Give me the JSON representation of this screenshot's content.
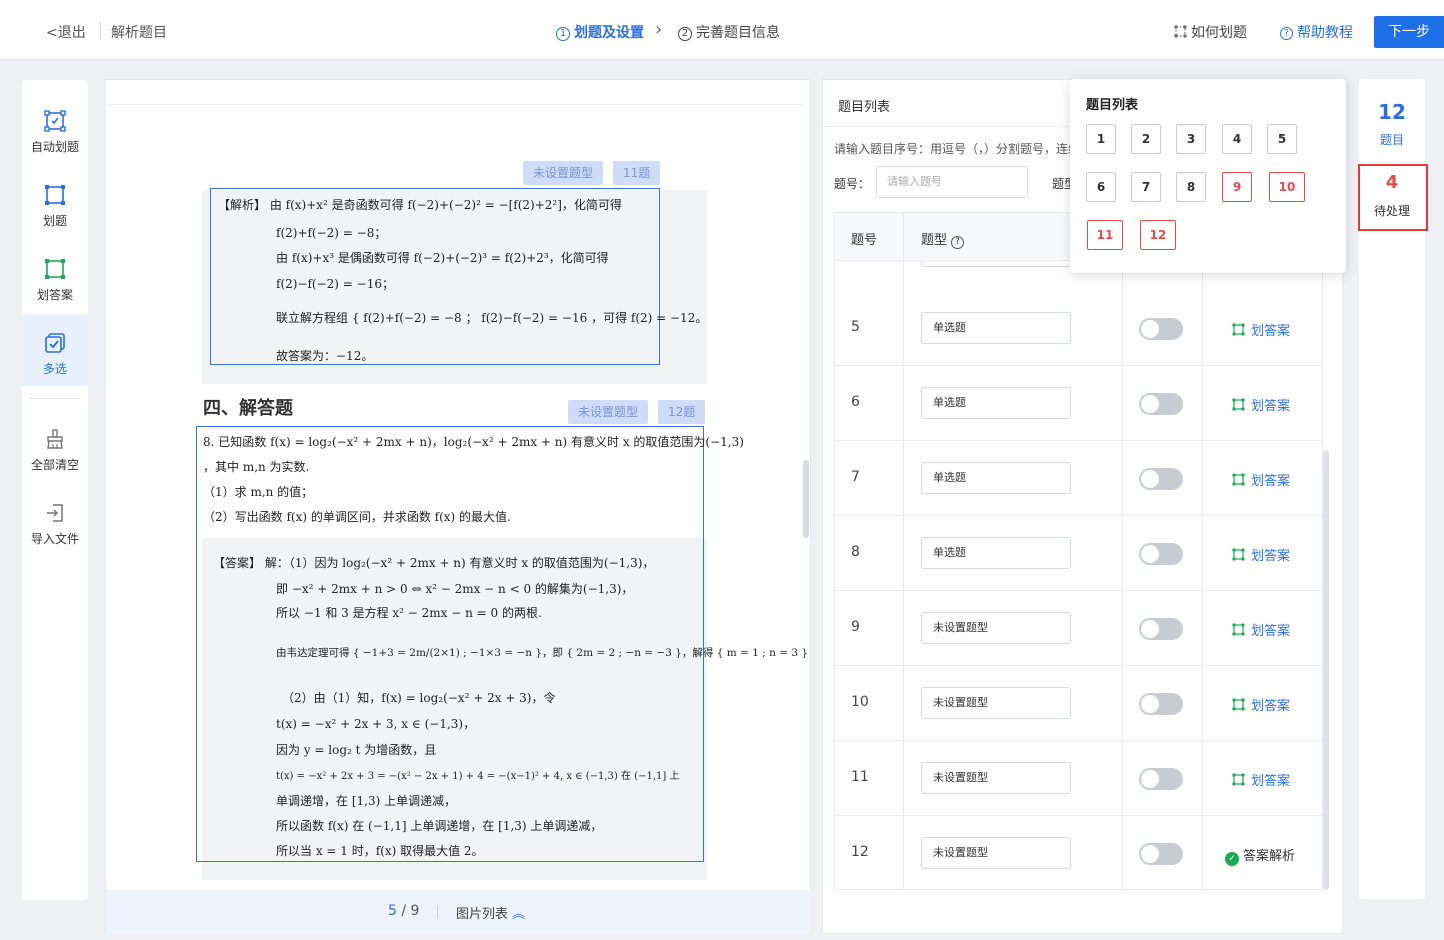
{
  "header": {
    "back_label": "退出",
    "page_title": "解析题目",
    "step1_num": "1",
    "step1_label": "划题及设置",
    "step2_num": "2",
    "step2_label": "完善题目信息",
    "howto_label": "如何划题",
    "help_label": "帮助教程",
    "next_label": "下一步"
  },
  "toolbar": {
    "items": [
      {
        "label": "自动划题",
        "icon": "auto-select-icon"
      },
      {
        "label": "划题",
        "icon": "frame-icon"
      },
      {
        "label": "划答案",
        "icon": "answer-frame-icon"
      },
      {
        "label": "多选",
        "icon": "multi-select-icon"
      },
      {
        "label": "全部清空",
        "icon": "broom-icon"
      },
      {
        "label": "导入文件",
        "icon": "import-icon"
      }
    ]
  },
  "document": {
    "tag_unset_1": "未设置题型",
    "tag_q11": "11题",
    "tag_unset_2": "未设置题型",
    "tag_q12": "12题",
    "section_title": "四、解答题",
    "analysis_lines": [
      "【解析】  由 f(x)+x² 是奇函数可得 f(−2)+(−2)² = −[f(2)+2²]，化简可得",
      "f(2)+f(−2) = −8；",
      "由 f(x)+x³ 是偶函数可得 f(−2)+(−2)³ = f(2)+2³，化简可得",
      "f(2)−f(−2) = −16；",
      "联立解方程组 { f(2)+f(−2) = −8 ； f(2)−f(−2) = −16 ，可得 f(2) = −12。",
      "故答案为：−12。"
    ],
    "question_lines": [
      "8. 已知函数 f(x) = log₂(−x² + 2mx + n)，log₂(−x² + 2mx + n) 有意义时 x 的取值范围为(−1,3)",
      "，其中 m,n 为实数.",
      "（1）求 m,n 的值；",
      "（2）写出函数 f(x) 的单调区间，并求函数 f(x) 的最大值."
    ],
    "answer_lines": [
      "【答案】  解：（1）因为 log₂(−x² + 2mx + n) 有意义时 x 的取值范围为(−1,3)，",
      "即 −x² + 2mx + n > 0 ⇔ x² − 2mx − n < 0 的解集为(−1,3)，",
      "所以 −1 和 3 是方程 x² − 2mx − n = 0 的两根.",
      "由韦达定理可得 { −1+3 = 2m/(2×1) ; −1×3 = −n }，即 { 2m = 2 ; −n = −3 }，解得 { m = 1 ; n = 3 }",
      "（2）由（1）知，f(x) = log₂(−x² + 2x + 3)，令",
      "t(x) = −x² + 2x + 3, x ∈ (−1,3)，",
      "因为 y = log₂ t 为增函数，且",
      "t(x) = −x² + 2x + 3 = −(x² − 2x + 1) + 4 = −(x−1)² + 4, x ∈ (−1,3) 在 (−1,1] 上",
      "单调递增，在 [1,3) 上单调递减，",
      "所以函数 f(x) 在 (−1,1] 上单调递增，在 [1,3) 上单调递减，",
      "所以当 x = 1 时，f(x) 取得最大值 2。"
    ],
    "pager_current": "5",
    "pager_sep": " / ",
    "pager_total": "9",
    "image_list_label": "图片列表"
  },
  "question_panel": {
    "title": "题目列表",
    "hint": "请输入题目序号：用逗号（，）分割题号，连续题号用短横线连接",
    "qnum_label": "题号：",
    "qnum_placeholder": "请输入题号",
    "qtype_label": "题型",
    "col_num": "题号",
    "col_type": "题型",
    "rows": [
      {
        "num": "5",
        "type": "单选题",
        "toggle": false,
        "action": "划答案",
        "done": false
      },
      {
        "num": "6",
        "type": "单选题",
        "toggle": false,
        "action": "划答案",
        "done": false
      },
      {
        "num": "7",
        "type": "单选题",
        "toggle": false,
        "action": "划答案",
        "done": false
      },
      {
        "num": "8",
        "type": "单选题",
        "toggle": false,
        "action": "划答案",
        "done": false
      },
      {
        "num": "9",
        "type": "未设置题型",
        "toggle": false,
        "action": "划答案",
        "done": false
      },
      {
        "num": "10",
        "type": "未设置题型",
        "toggle": false,
        "action": "划答案",
        "done": false
      },
      {
        "num": "11",
        "type": "未设置题型",
        "toggle": false,
        "action": "划答案",
        "done": false
      },
      {
        "num": "12",
        "type": "未设置题型",
        "toggle": false,
        "action": "答案解析",
        "done": true
      }
    ]
  },
  "popover": {
    "title": "题目列表",
    "buttons": [
      {
        "label": "1",
        "pending": false
      },
      {
        "label": "2",
        "pending": false
      },
      {
        "label": "3",
        "pending": false
      },
      {
        "label": "4",
        "pending": false
      },
      {
        "label": "5",
        "pending": false
      },
      {
        "label": "6",
        "pending": false
      },
      {
        "label": "7",
        "pending": false
      },
      {
        "label": "8",
        "pending": false
      },
      {
        "label": "9",
        "pending": true
      },
      {
        "label": "10",
        "pending": true
      },
      {
        "label": "11",
        "pending": true
      },
      {
        "label": "12",
        "pending": true
      }
    ]
  },
  "stats": {
    "total_num": "12",
    "total_label": "题目",
    "pending_num": "4",
    "pending_label": "待处理"
  },
  "colors": {
    "accent": "#1e6ee8",
    "pending": "#e64b4b",
    "done": "#1aaa55"
  }
}
